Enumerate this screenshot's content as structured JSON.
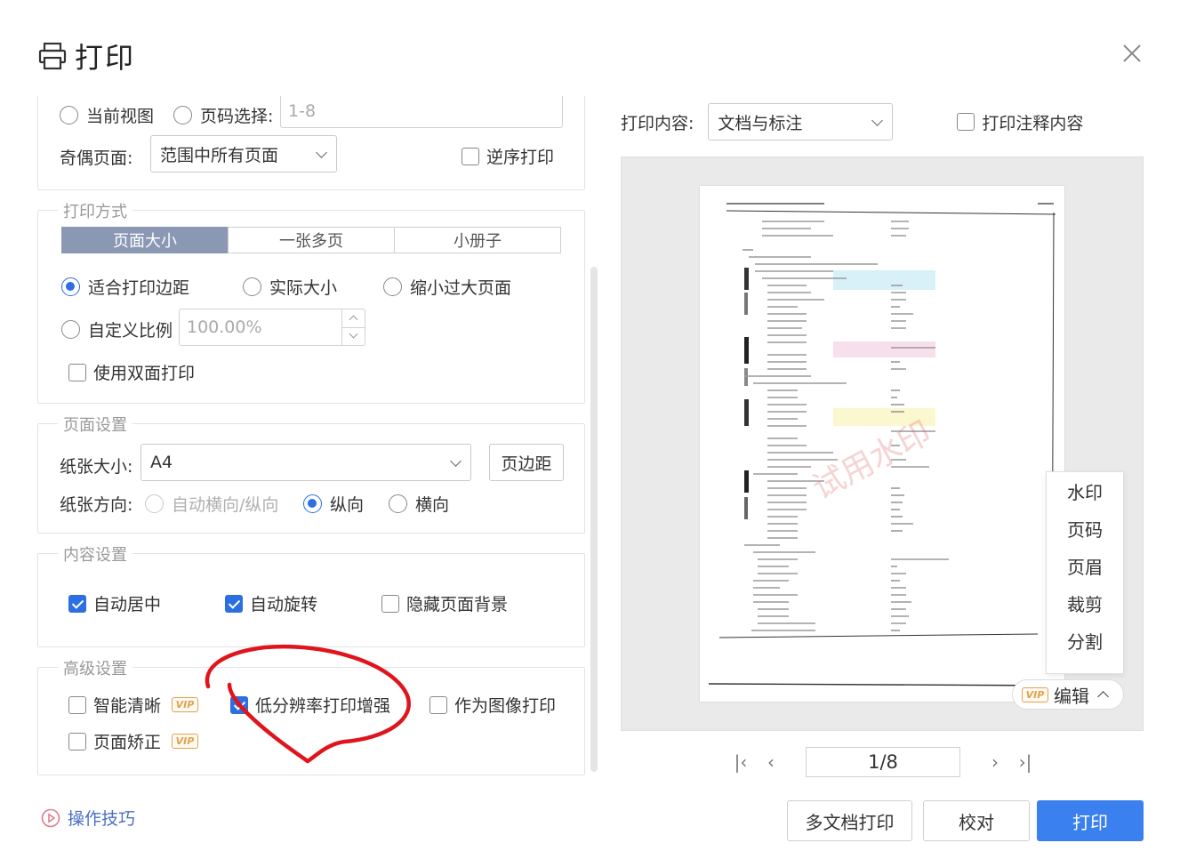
{
  "dialog": {
    "title": "打印"
  },
  "range": {
    "current_view": "当前视图",
    "page_select": "页码选择:",
    "page_select_value": "1-8",
    "odd_even_label": "奇偶页面:",
    "odd_even_value": "范围中所有页面",
    "reverse_label": "逆序打印"
  },
  "print_mode": {
    "legend": "打印方式",
    "tabs": [
      "页面大小",
      "一张多页",
      "小册子"
    ],
    "fit_margin": "适合打印边距",
    "actual_size": "实际大小",
    "shrink_large": "缩小过大页面",
    "custom_scale": "自定义比例",
    "custom_scale_value": "100.00%",
    "duplex": "使用双面打印"
  },
  "page_setup": {
    "legend": "页面设置",
    "paper_size_label": "纸张大小:",
    "paper_size_value": "A4",
    "margin_button": "页边距",
    "orientation_label": "纸张方向:",
    "orient_auto": "自动横向/纵向",
    "orient_portrait": "纵向",
    "orient_landscape": "横向"
  },
  "content_setup": {
    "legend": "内容设置",
    "auto_center": "自动居中",
    "auto_rotate": "自动旋转",
    "hide_bg": "隐藏页面背景"
  },
  "advanced": {
    "legend": "高级设置",
    "smart_clear": "智能清晰",
    "low_res_enhance": "低分辨率打印增强",
    "as_image": "作为图像打印",
    "page_correct": "页面矫正",
    "vip": "VIP"
  },
  "preview": {
    "content_label": "打印内容:",
    "content_value": "文档与标注",
    "print_comments": "打印注释内容",
    "watermark": "试用水印",
    "edit_menu": [
      "水印",
      "页码",
      "页眉",
      "裁剪",
      "分割"
    ],
    "edit_button": "编辑",
    "page_indicator": "1/8"
  },
  "footer": {
    "help": "操作技巧",
    "multi_doc": "多文档打印",
    "proofread": "校对",
    "print": "打印"
  },
  "colors": {
    "accent": "#3a80ef",
    "tab_active": "#8a98b4",
    "vip": "#e0a24e",
    "annotation": "#e0141c"
  }
}
